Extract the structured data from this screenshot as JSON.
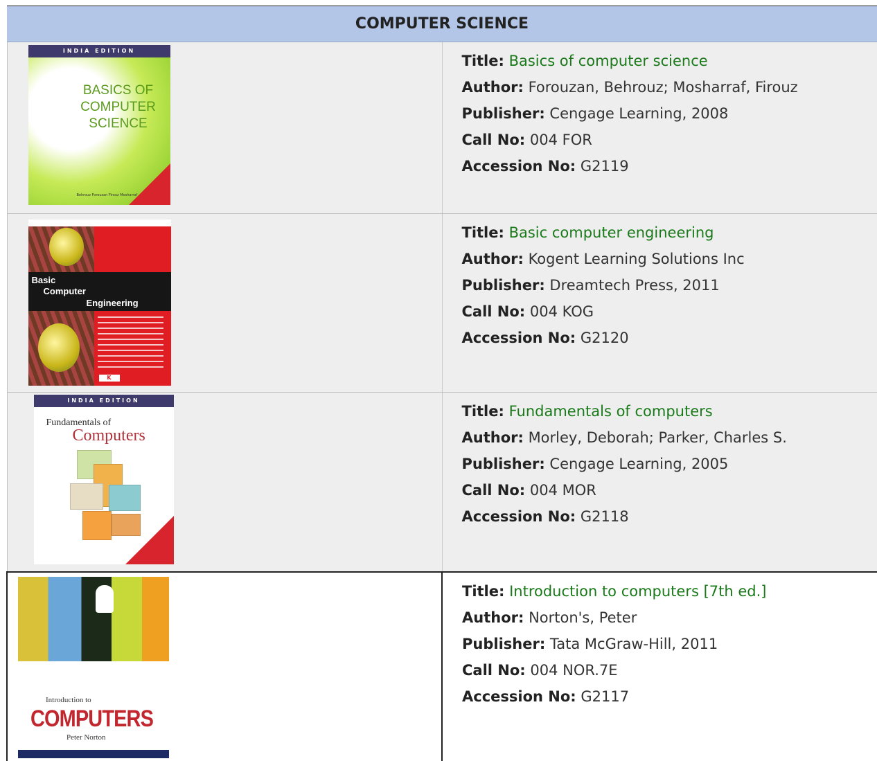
{
  "table": {
    "header": "COMPUTER SCIENCE",
    "labels": {
      "title": "Title:",
      "author": "Author:",
      "publisher": "Publisher:",
      "call_no": "Call No:",
      "accession_no": "Accession No:"
    },
    "books": [
      {
        "title": "Basics of computer science",
        "author": "Forouzan, Behrouz; Mosharraf, Firouz",
        "publisher": "Cengage Learning, 2008",
        "call_no": "004 FOR",
        "accession_no": "G2119",
        "cover": {
          "edition_band": "INDIA EDITION",
          "cover_title": "BASICS OF COMPUTER SCIENCE",
          "cover_authors": "Behrouz Forouzan Firouz Mosharraf"
        }
      },
      {
        "title": "Basic computer engineering",
        "author": "Kogent Learning Solutions Inc",
        "publisher": "Dreamtech Press, 2011",
        "call_no": "004 KOG",
        "accession_no": "G2120",
        "cover": {
          "line1": "Basic",
          "line2": "Computer",
          "line3": "Engineering",
          "logo": "K OENT"
        }
      },
      {
        "title": "Fundamentals of computers",
        "author": "Morley, Deborah; Parker, Charles S.",
        "publisher": "Cengage Learning, 2005",
        "call_no": "004 MOR",
        "accession_no": "G2118",
        "cover": {
          "edition_band": "INDIA EDITION",
          "line1": "Fundamentals of",
          "line2": "Computers"
        }
      },
      {
        "title": "Introduction to computers [7th ed.]",
        "author": "Norton's, Peter",
        "publisher": "Tata McGraw-Hill, 2011",
        "call_no": "004 NOR.7E",
        "accession_no": "G2117",
        "cover": {
          "line1": "Introduction to",
          "line2": "COMPUTERS",
          "line3": "Peter Norton"
        }
      }
    ]
  }
}
